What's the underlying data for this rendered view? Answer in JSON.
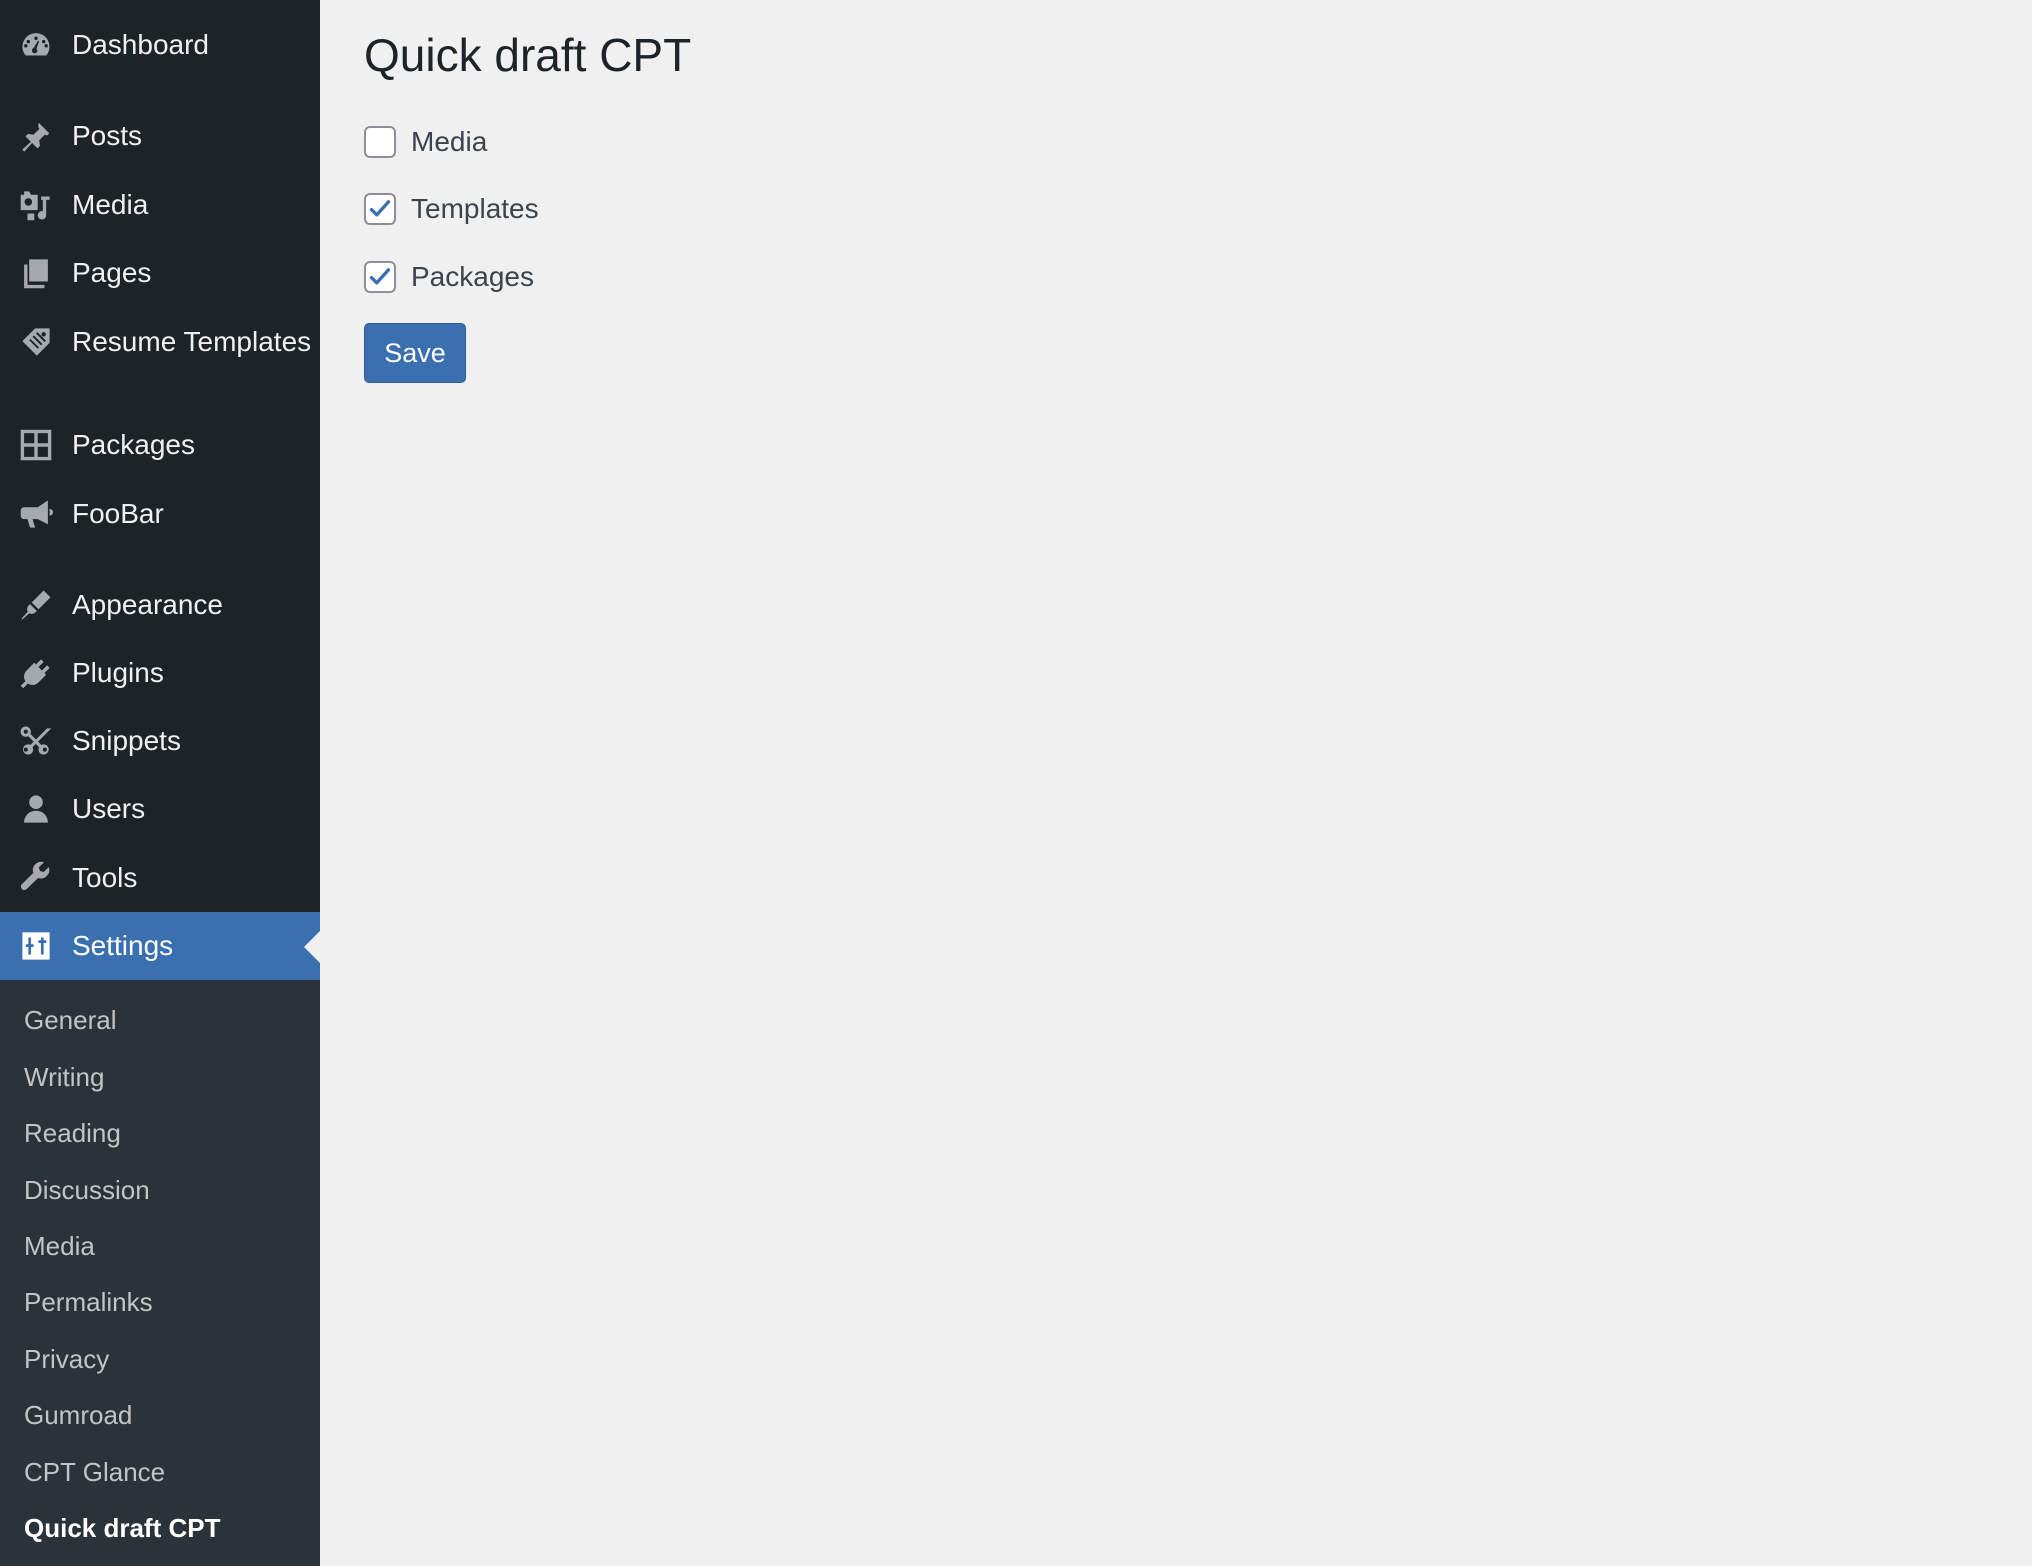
{
  "sidebar": {
    "items": [
      {
        "label": "Dashboard",
        "icon": "dashboard-icon"
      },
      {
        "label": "Posts",
        "icon": "pushpin-icon"
      },
      {
        "label": "Media",
        "icon": "media-icon"
      },
      {
        "label": "Pages",
        "icon": "pages-icon"
      },
      {
        "label": "Resume Templates",
        "icon": "tag-icon"
      },
      {
        "label": "Packages",
        "icon": "grid-icon"
      },
      {
        "label": "FooBar",
        "icon": "megaphone-icon"
      },
      {
        "label": "Appearance",
        "icon": "paintbrush-icon"
      },
      {
        "label": "Plugins",
        "icon": "plug-icon"
      },
      {
        "label": "Snippets",
        "icon": "scissors-icon"
      },
      {
        "label": "Users",
        "icon": "user-icon"
      },
      {
        "label": "Tools",
        "icon": "wrench-icon"
      },
      {
        "label": "Settings",
        "icon": "settings-icon"
      }
    ],
    "active_item": "Settings",
    "submenu": [
      {
        "label": "General"
      },
      {
        "label": "Writing"
      },
      {
        "label": "Reading"
      },
      {
        "label": "Discussion"
      },
      {
        "label": "Media"
      },
      {
        "label": "Permalinks"
      },
      {
        "label": "Privacy"
      },
      {
        "label": "Gumroad"
      },
      {
        "label": "CPT Glance"
      },
      {
        "label": "Quick draft CPT"
      }
    ],
    "current_submenu": "Quick draft CPT"
  },
  "main": {
    "title": "Quick draft CPT",
    "options": [
      {
        "label": "Media",
        "checked": false
      },
      {
        "label": "Templates",
        "checked": true
      },
      {
        "label": "Packages",
        "checked": true
      }
    ],
    "save_label": "Save"
  },
  "colors": {
    "sidebar_bg": "#1d2327",
    "submenu_bg": "#2c3338",
    "accent": "#3a6fb0",
    "page_bg": "#f0f0f1",
    "check": "#3a6fb0"
  }
}
